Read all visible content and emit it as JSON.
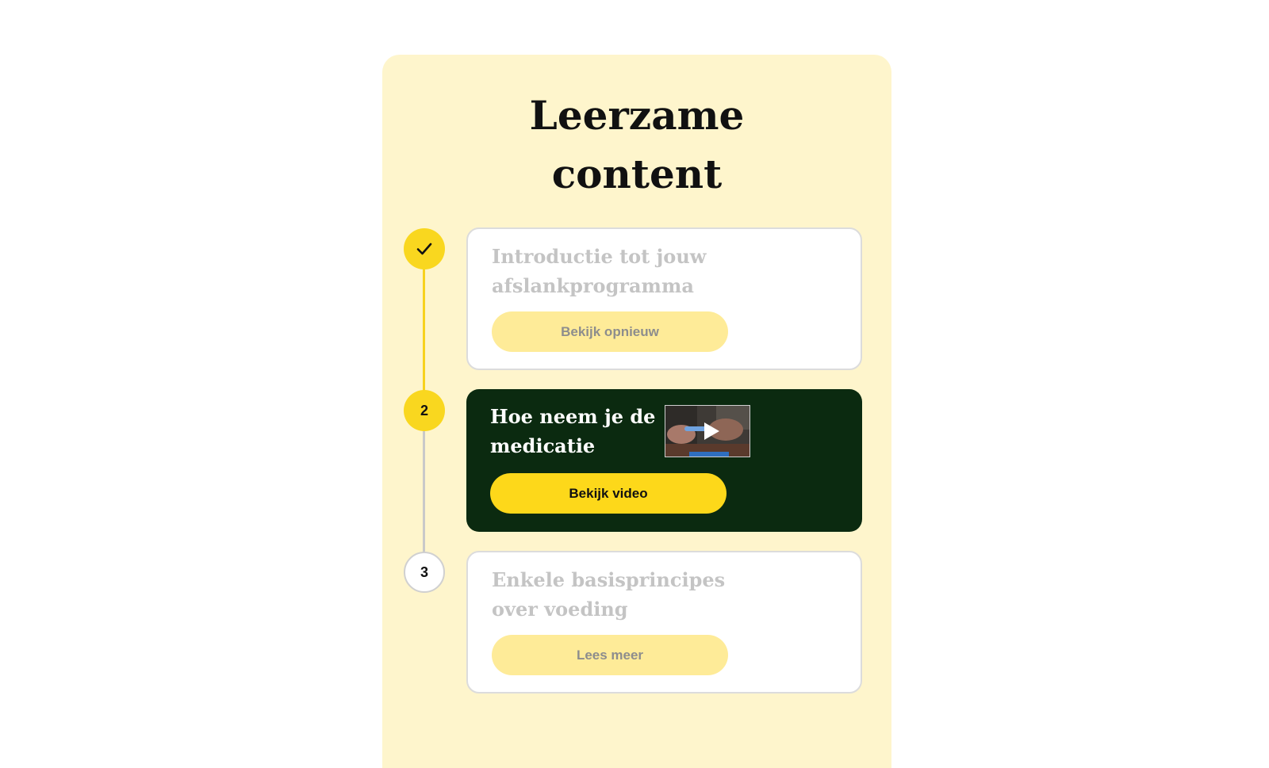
{
  "section": {
    "title_line1": "Leerzame",
    "title_line2": "content"
  },
  "steps": [
    {
      "status": "completed",
      "marker_icon": "check-icon",
      "title": "Introductie tot jouw afslankprogramma",
      "button_label": "Bekijk opnieuw"
    },
    {
      "status": "current",
      "marker_label": "2",
      "title": "Hoe neem je de medicatie",
      "button_label": "Bekijk video",
      "thumbnail_icon": "play-icon"
    },
    {
      "status": "upcoming",
      "marker_label": "3",
      "title": "Enkele basisprincipes over voeding",
      "button_label": "Lees meer"
    }
  ],
  "colors": {
    "panel_background": "#fef5cc",
    "accent_yellow": "#fdd81a",
    "muted_button": "#feeb98",
    "active_card": "#0b2a10",
    "muted_text": "#c4c4c4"
  }
}
